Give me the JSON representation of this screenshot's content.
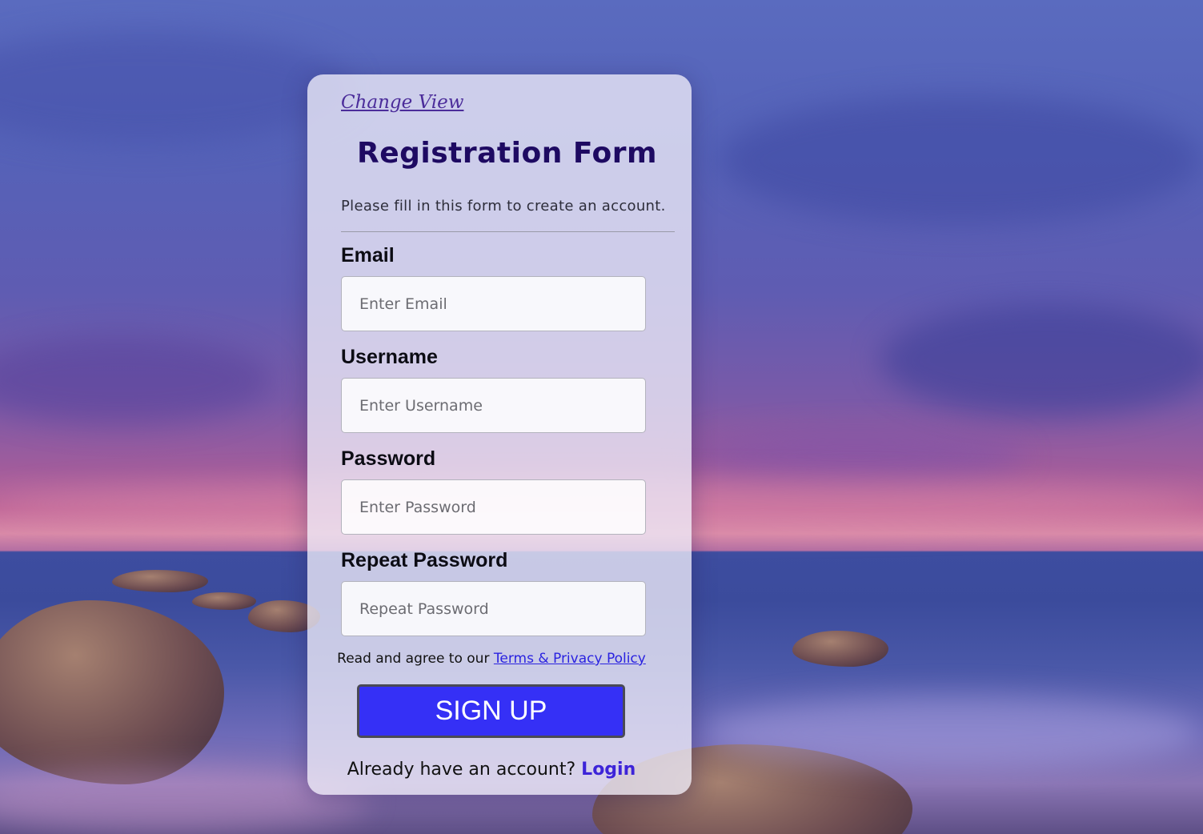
{
  "theme": {
    "card_bg": "#eeecf8",
    "title_color": "#1e0a62",
    "link_color": "#4b2c9a",
    "button_color": "#3530f6",
    "login_color": "#3d24d8"
  },
  "header": {
    "change_view_link": "Change View",
    "title": "Registration Form",
    "subtitle": "Please fill in this form to create an account."
  },
  "fields": [
    {
      "label": "Email",
      "placeholder": "Enter Email",
      "value": ""
    },
    {
      "label": "Username",
      "placeholder": "Enter Username",
      "value": ""
    },
    {
      "label": "Password",
      "placeholder": "Enter Password",
      "value": ""
    },
    {
      "label": "Repeat Password",
      "placeholder": "Repeat Password",
      "value": ""
    }
  ],
  "terms": {
    "prefix": "Read and agree to our",
    "link": "Terms & Privacy Policy"
  },
  "signup_button": "SIGN UP",
  "login": {
    "prefix": "Already have an account?",
    "link": "Login"
  }
}
